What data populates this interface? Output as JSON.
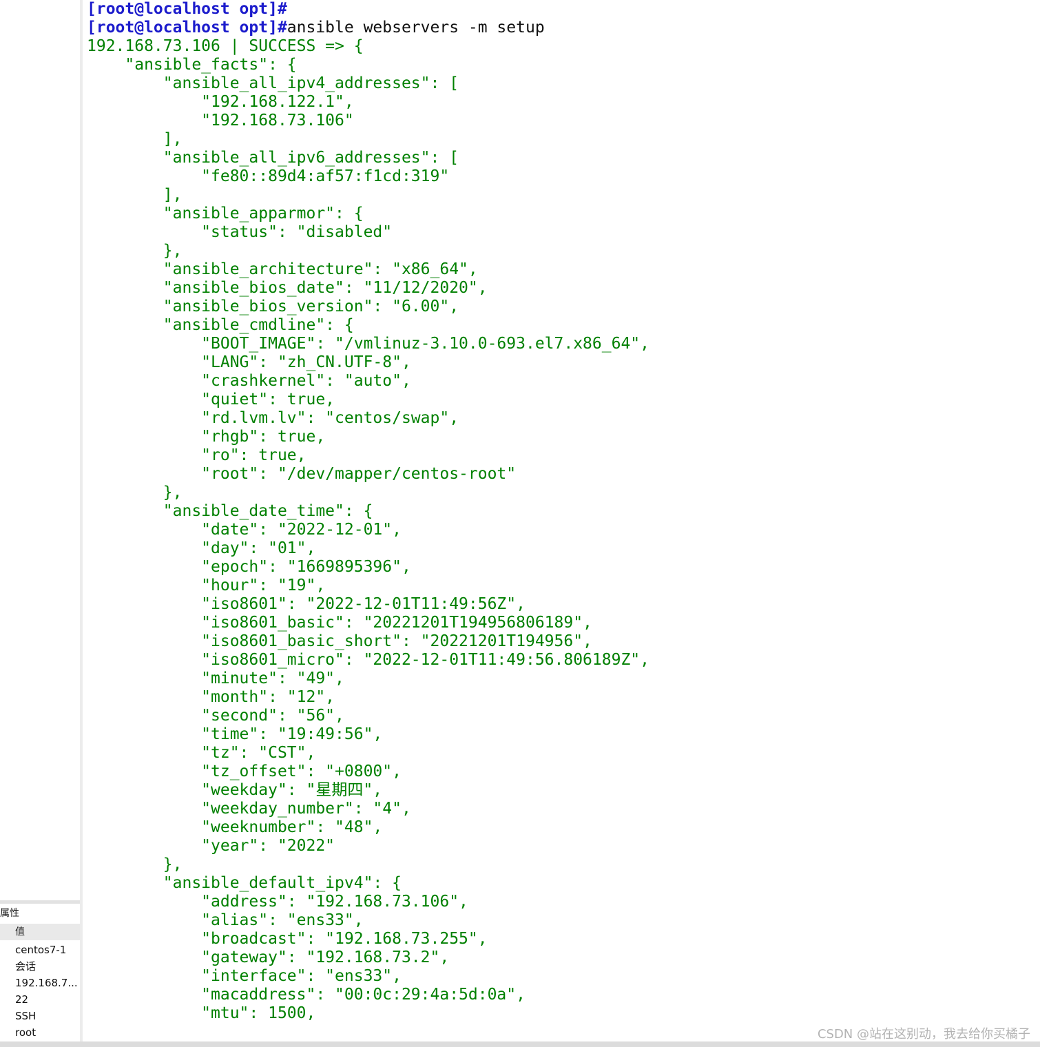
{
  "sidebar": {
    "panel_title": "属性",
    "column_header": "值",
    "values": [
      "centos7-1",
      "会话",
      "192.168.7...",
      "22",
      "SSH",
      "root"
    ]
  },
  "terminal": {
    "prompt": "[root@localhost opt]#",
    "command": "ansible webservers -m setup",
    "output": [
      "192.168.73.106 | SUCCESS => {",
      "    \"ansible_facts\": {",
      "        \"ansible_all_ipv4_addresses\": [",
      "            \"192.168.122.1\",",
      "            \"192.168.73.106\"",
      "        ],",
      "        \"ansible_all_ipv6_addresses\": [",
      "            \"fe80::89d4:af57:f1cd:319\"",
      "        ],",
      "        \"ansible_apparmor\": {",
      "            \"status\": \"disabled\"",
      "        },",
      "        \"ansible_architecture\": \"x86_64\",",
      "        \"ansible_bios_date\": \"11/12/2020\",",
      "        \"ansible_bios_version\": \"6.00\",",
      "        \"ansible_cmdline\": {",
      "            \"BOOT_IMAGE\": \"/vmlinuz-3.10.0-693.el7.x86_64\",",
      "            \"LANG\": \"zh_CN.UTF-8\",",
      "            \"crashkernel\": \"auto\",",
      "            \"quiet\": true,",
      "            \"rd.lvm.lv\": \"centos/swap\",",
      "            \"rhgb\": true,",
      "            \"ro\": true,",
      "            \"root\": \"/dev/mapper/centos-root\"",
      "        },",
      "        \"ansible_date_time\": {",
      "            \"date\": \"2022-12-01\",",
      "            \"day\": \"01\",",
      "            \"epoch\": \"1669895396\",",
      "            \"hour\": \"19\",",
      "            \"iso8601\": \"2022-12-01T11:49:56Z\",",
      "            \"iso8601_basic\": \"20221201T194956806189\",",
      "            \"iso8601_basic_short\": \"20221201T194956\",",
      "            \"iso8601_micro\": \"2022-12-01T11:49:56.806189Z\",",
      "            \"minute\": \"49\",",
      "            \"month\": \"12\",",
      "            \"second\": \"56\",",
      "            \"time\": \"19:49:56\",",
      "            \"tz\": \"CST\",",
      "            \"tz_offset\": \"+0800\",",
      "            \"weekday\": \"星期四\",",
      "            \"weekday_number\": \"4\",",
      "            \"weeknumber\": \"48\",",
      "            \"year\": \"2022\"",
      "        },",
      "        \"ansible_default_ipv4\": {",
      "            \"address\": \"192.168.73.106\",",
      "            \"alias\": \"ens33\",",
      "            \"broadcast\": \"192.168.73.255\",",
      "            \"gateway\": \"192.168.73.2\",",
      "            \"interface\": \"ens33\",",
      "            \"macaddress\": \"00:0c:29:4a:5d:0a\",",
      "            \"mtu\": 1500,"
    ]
  },
  "watermark": "CSDN @站在这别动，我去给你买橘子",
  "colors": {
    "prompt": "#1c1ccc",
    "output": "#008000",
    "command": "#111111"
  }
}
